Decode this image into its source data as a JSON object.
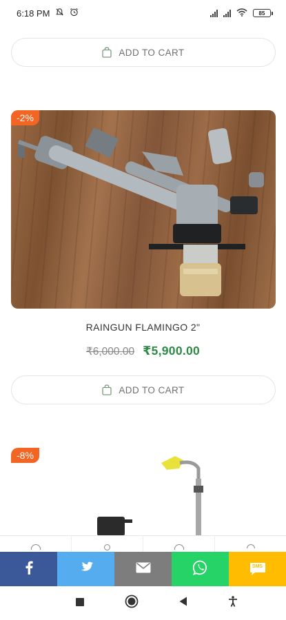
{
  "status_bar": {
    "time": "6:18 PM",
    "battery": "85"
  },
  "cart_button_label": "ADD TO CART",
  "products": [
    {
      "discount": "-2%",
      "title": "RAINGUN FLAMINGO 2\"",
      "old_price": "₹6,000.00",
      "new_price": "₹5,900.00"
    },
    {
      "discount": "-8%"
    }
  ],
  "share_bar": {
    "colors": {
      "facebook": "#3b5998",
      "twitter": "#55acee",
      "email": "#7d7d7d",
      "whatsapp": "#25d366",
      "sms": "#ffbc00"
    },
    "sms_label": "SMS"
  },
  "accent": {
    "discount_badge": "#f26522",
    "price": "#2e8b45"
  },
  "icons": [
    "alarm-off-icon",
    "alarm-clock-icon",
    "signal-icon",
    "wifi-icon",
    "battery-icon",
    "shopping-bag-icon",
    "facebook-icon",
    "twitter-icon",
    "email-icon",
    "whatsapp-icon",
    "sms-icon",
    "recent-apps-icon",
    "home-icon",
    "back-icon",
    "accessibility-icon"
  ]
}
